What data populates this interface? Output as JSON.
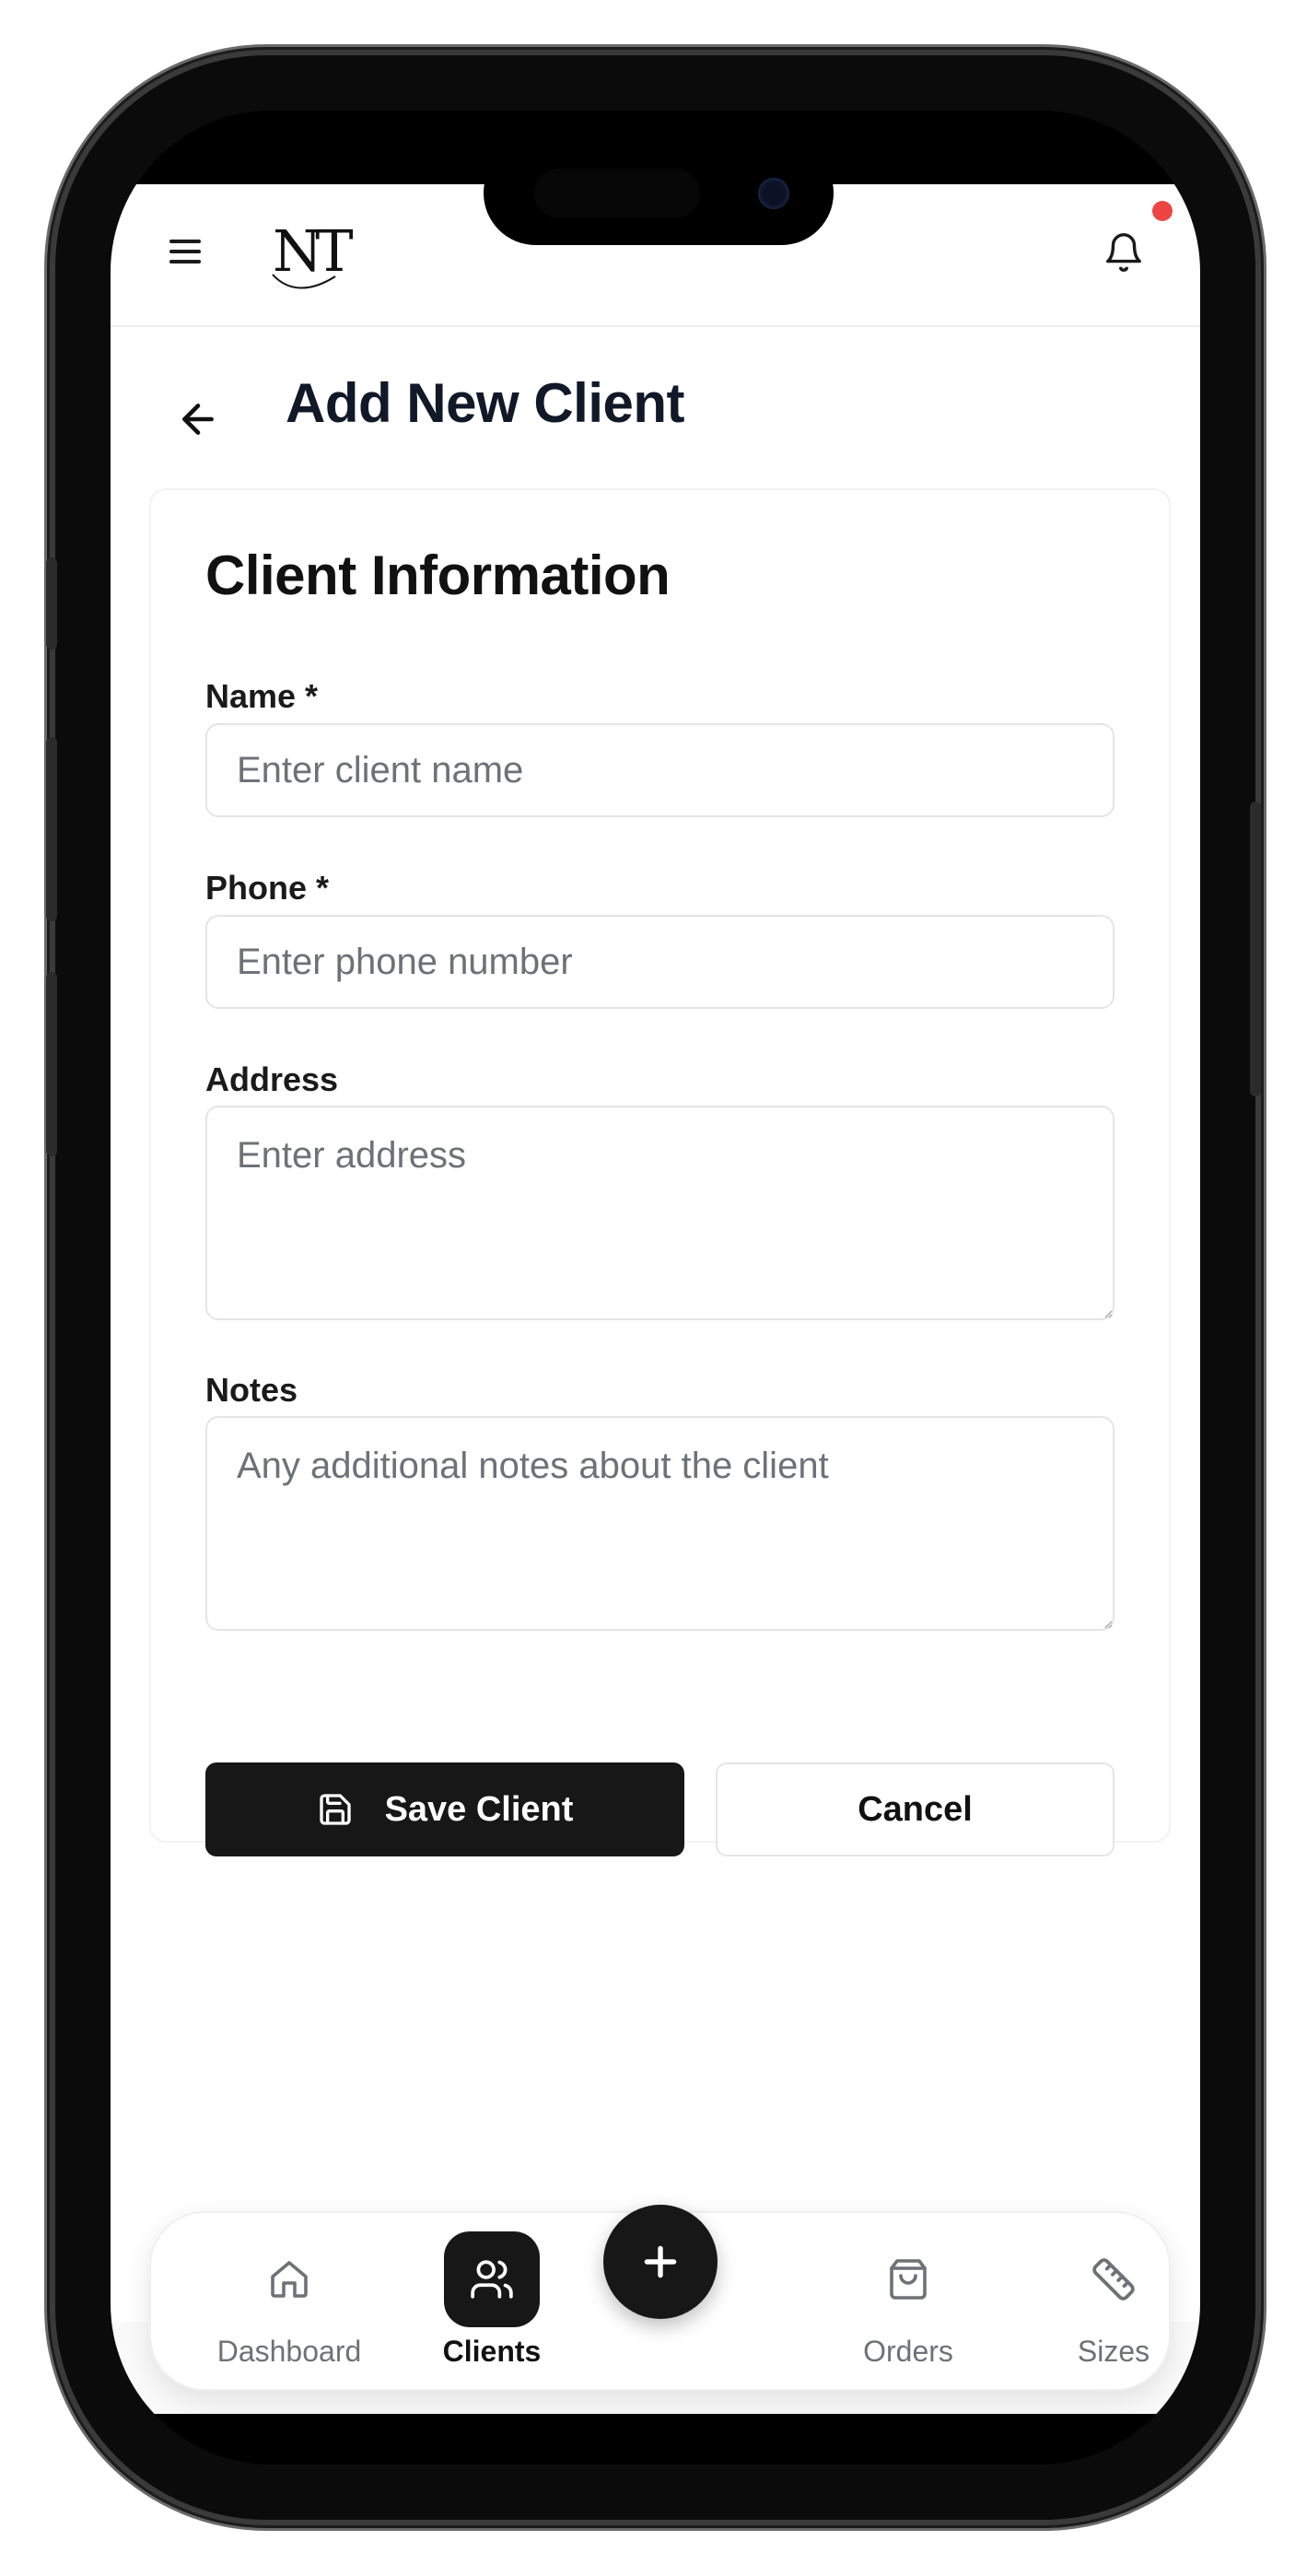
{
  "header": {
    "logo_text": "NT",
    "notification_unread": true
  },
  "page": {
    "title": "Add New Client"
  },
  "form": {
    "section_title": "Client Information",
    "name": {
      "label": "Name *",
      "placeholder": "Enter client name",
      "value": ""
    },
    "phone": {
      "label": "Phone *",
      "placeholder": "Enter phone number",
      "value": ""
    },
    "address": {
      "label": "Address",
      "placeholder": "Enter address",
      "value": ""
    },
    "notes": {
      "label": "Notes",
      "placeholder": "Any additional notes about the client",
      "value": ""
    },
    "save_label": "Save Client",
    "cancel_label": "Cancel"
  },
  "bottom_nav": {
    "items": [
      {
        "label": "Dashboard",
        "icon": "home-icon",
        "active": false
      },
      {
        "label": "Clients",
        "icon": "users-icon",
        "active": true
      },
      {
        "label": "Orders",
        "icon": "shopping-bag-icon",
        "active": false
      },
      {
        "label": "Sizes",
        "icon": "ruler-icon",
        "active": false
      }
    ],
    "fab_icon": "plus-icon"
  },
  "colors": {
    "primary": "#171717",
    "notification_dot": "#ef4444",
    "title_text": "#111827",
    "placeholder_text": "#6e7176",
    "border": "#e3e5e8"
  }
}
